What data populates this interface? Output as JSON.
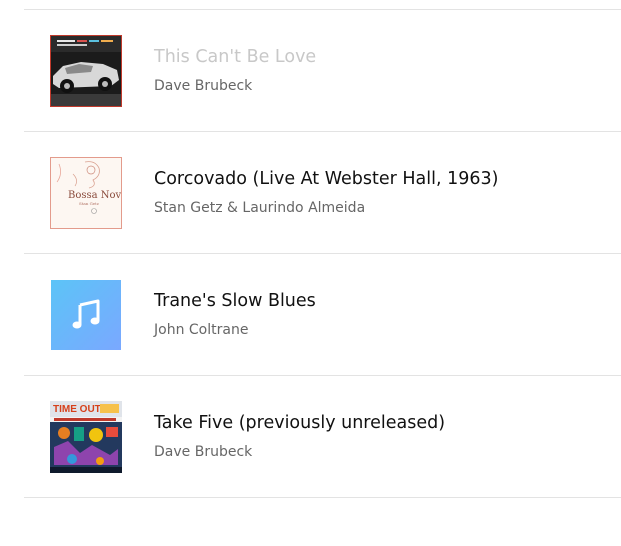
{
  "tracks": [
    {
      "title": "This Can't Be Love",
      "artist": "Dave Brubeck",
      "artwork": "convertible-car-album-art",
      "dimmed": true
    },
    {
      "title": "Corcovado (Live At Webster Hall, 1963)",
      "artist": "Stan Getz & Laurindo Almeida",
      "artwork": "bossa-nova-album-art",
      "art_text": "Bossa Nova"
    },
    {
      "title": "Trane's Slow Blues",
      "artist": "John Coltrane",
      "artwork": "music-note-placeholder-icon"
    },
    {
      "title": "Take Five (previously unreleased)",
      "artist": "Dave Brubeck",
      "artwork": "time-out-album-art",
      "art_text": "TIME OUT"
    }
  ],
  "colors": {
    "divider": "#e3e3e3",
    "title": "#111111",
    "title_dimmed": "#c8c8c8",
    "artist": "#666666",
    "placeholder_gradient_start": "#5cc4f7",
    "placeholder_gradient_end": "#7aa8ff"
  }
}
